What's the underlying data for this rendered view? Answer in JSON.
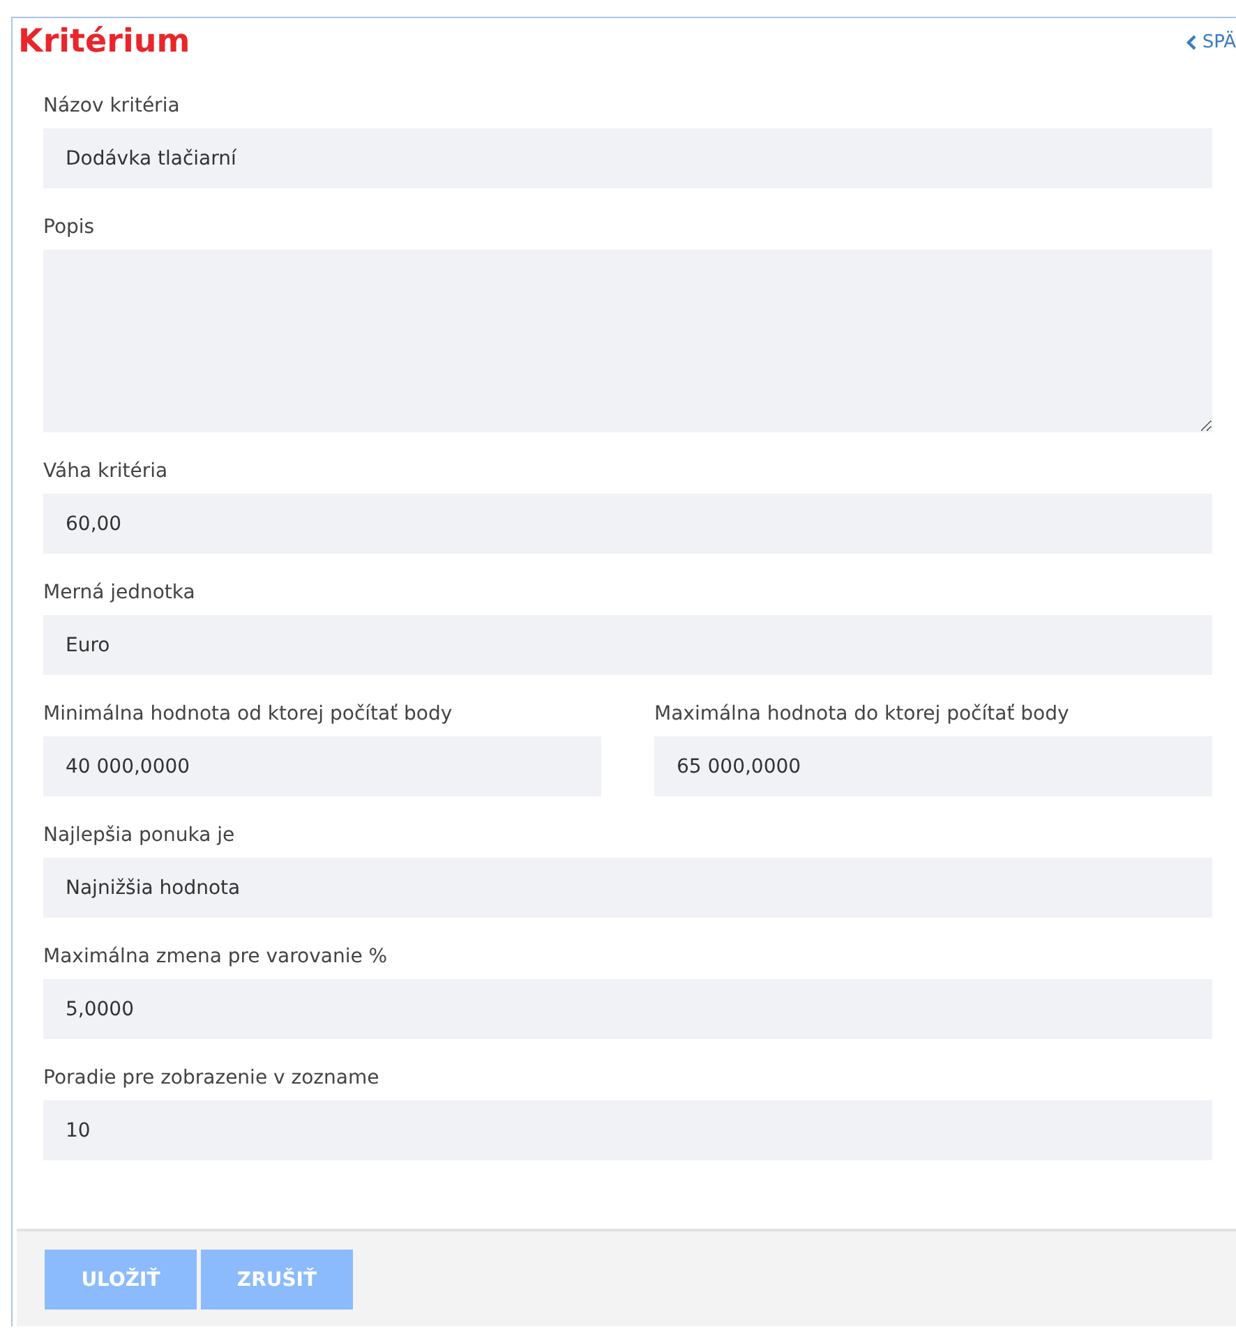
{
  "header": {
    "title": "Kritérium",
    "back_link": "SPÄ"
  },
  "rows": [
    {
      "fields": [
        {
          "kind": "input",
          "label": "Názov kritéria",
          "value": "Dodávka tlačiarní"
        }
      ]
    },
    {
      "fields": [
        {
          "kind": "textarea",
          "label": "Popis"
        }
      ]
    },
    {
      "fields": [
        {
          "kind": "input",
          "label": "Váha kritéria",
          "value": "60,00"
        }
      ]
    },
    {
      "fields": [
        {
          "kind": "input",
          "label": "Merná jednotka",
          "value": "Euro"
        }
      ]
    },
    {
      "fields": [
        {
          "kind": "input",
          "label": "Minimálna hodnota od ktorej počítať body",
          "value": "40 000,0000"
        },
        {
          "kind": "input",
          "label": "Maximálna hodnota do ktorej počítať body",
          "value": "65 000,0000"
        }
      ]
    },
    {
      "fields": [
        {
          "kind": "input",
          "label": "Najlepšia ponuka je",
          "value": "Najnižšia hodnota"
        }
      ]
    },
    {
      "fields": [
        {
          "kind": "input",
          "label": "Maximálna zmena pre varovanie %",
          "value": "5,0000"
        }
      ]
    },
    {
      "fields": [
        {
          "kind": "input",
          "label": "Poradie pre zobrazenie v zozname",
          "value": "10"
        }
      ]
    }
  ],
  "buttons": [
    {
      "label": "ULOŽIŤ",
      "disabled": true
    },
    {
      "label": "ZRUŠIŤ",
      "disabled": true
    }
  ]
}
